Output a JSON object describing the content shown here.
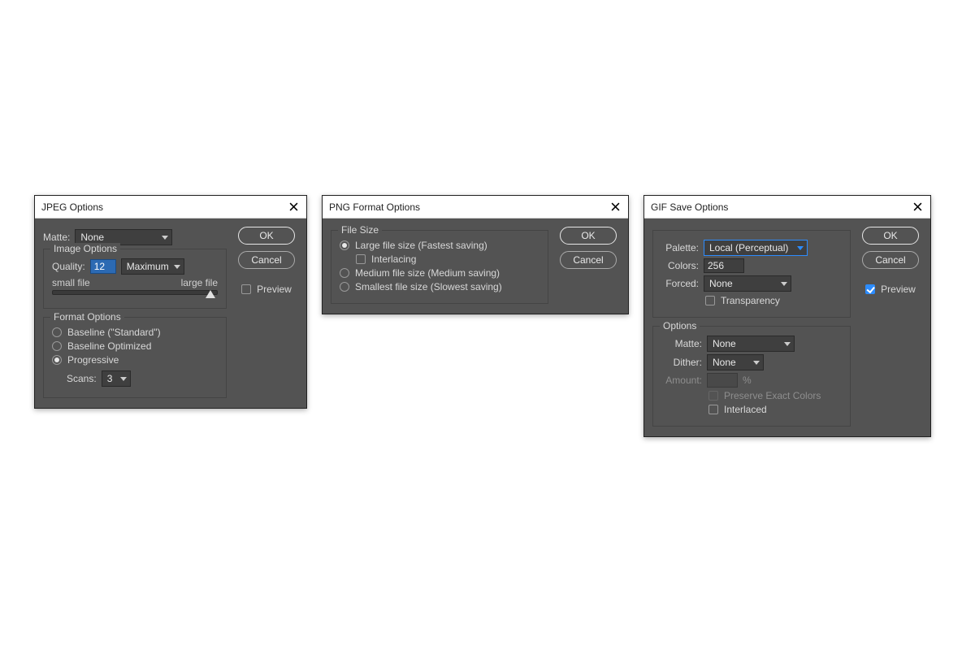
{
  "jpeg": {
    "title": "JPEG Options",
    "ok": "OK",
    "cancel": "Cancel",
    "preview": "Preview",
    "preview_checked": false,
    "matte_label": "Matte:",
    "matte_value": "None",
    "image_options_legend": "Image Options",
    "quality_label": "Quality:",
    "quality_value": "12",
    "quality_preset": "Maximum",
    "slider_low": "small file",
    "slider_high": "large file",
    "slider_pos_pct": 96,
    "format_options_legend": "Format Options",
    "radio_baseline_std": "Baseline (\"Standard\")",
    "radio_baseline_opt": "Baseline Optimized",
    "radio_progressive": "Progressive",
    "selected_format": "progressive",
    "scans_label": "Scans:",
    "scans_value": "3"
  },
  "png": {
    "title": "PNG Format Options",
    "ok": "OK",
    "cancel": "Cancel",
    "filesize_legend": "File Size",
    "radio_large": "Large file size (Fastest saving)",
    "interlacing": "Interlacing",
    "interlacing_checked": false,
    "radio_medium": "Medium file size (Medium saving)",
    "radio_small": "Smallest file size (Slowest saving)",
    "selected_filesize": "large"
  },
  "gif": {
    "title": "GIF Save Options",
    "ok": "OK",
    "cancel": "Cancel",
    "preview": "Preview",
    "preview_checked": true,
    "palette_label": "Palette:",
    "palette_value": "Local (Perceptual)",
    "colors_label": "Colors:",
    "colors_value": "256",
    "forced_label": "Forced:",
    "forced_value": "None",
    "transparency_label": "Transparency",
    "transparency_checked": false,
    "options_legend": "Options",
    "matte_label": "Matte:",
    "matte_value": "None",
    "dither_label": "Dither:",
    "dither_value": "None",
    "amount_label": "Amount:",
    "amount_percent": "%",
    "preserve_exact_label": "Preserve Exact Colors",
    "interlaced_label": "Interlaced",
    "interlaced_checked": false
  }
}
